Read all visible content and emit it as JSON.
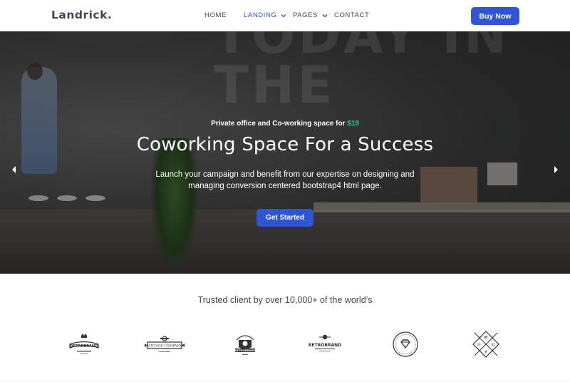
{
  "header": {
    "logo": "Landrick.",
    "nav": [
      {
        "label": "HOME",
        "active": false,
        "dropdown": false
      },
      {
        "label": "LANDING",
        "active": true,
        "dropdown": true
      },
      {
        "label": "PAGES",
        "active": false,
        "dropdown": true
      },
      {
        "label": "CONTACT",
        "active": false,
        "dropdown": false
      }
    ],
    "buy_label": "Buy Now"
  },
  "hero": {
    "subtitle_text": "Private office and Co-working space for ",
    "subtitle_price": "$19",
    "title": "Coworking Space For a Success",
    "description": "Launch your campaign and benefit from our expertise on designing and managing conversion centered bootstrap4 html page.",
    "cta_label": "Get Started",
    "background_wall_text": "TODAY IN THE"
  },
  "clients": {
    "title": "Trusted client by over 10,000+ of the world’s",
    "logos": [
      {
        "name": "RETROBRAND",
        "icon": "crown-badge-logo"
      },
      {
        "name": "VINTAGE COMPANY",
        "icon": "ribbon-banner-logo"
      },
      {
        "name": "RETROBRAND",
        "icon": "shield-emblem-logo"
      },
      {
        "name": "RETROBRAND",
        "icon": "star-banner-logo"
      },
      {
        "name": "PREMIUM PRODUCT",
        "icon": "diamond-circle-logo"
      },
      {
        "name": "H T 20 02",
        "icon": "crossed-arrows-diamond-logo"
      }
    ]
  },
  "colors": {
    "primary": "#2f55d4",
    "success": "#2eca8b",
    "text_dark": "#3c4858"
  }
}
